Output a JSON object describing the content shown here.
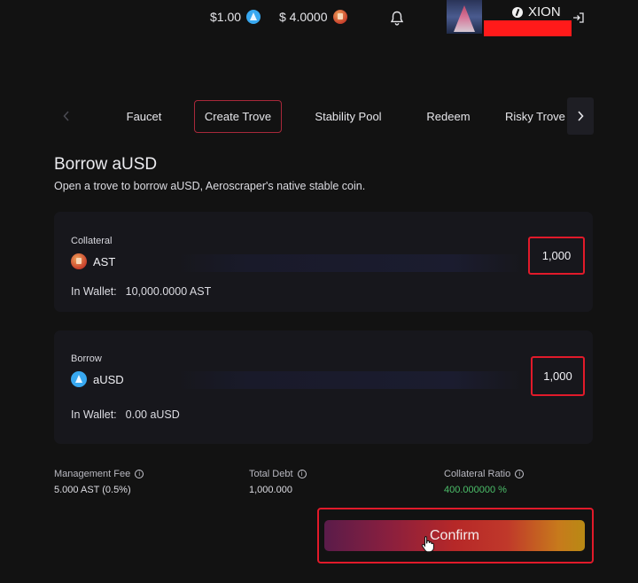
{
  "header": {
    "prices": [
      {
        "value": "$1.00",
        "icon": "ausd-coin-icon"
      },
      {
        "value": "$ 4.0000",
        "icon": "ast-coin-icon"
      }
    ],
    "chain": "XION"
  },
  "tabs": {
    "items": [
      {
        "label": "Faucet"
      },
      {
        "label": "Create Trove",
        "active": true
      },
      {
        "label": "Stability Pool"
      },
      {
        "label": "Redeem"
      },
      {
        "label": "Risky Trove"
      }
    ]
  },
  "page": {
    "title": "Borrow aUSD",
    "subtitle": "Open a trove to borrow aUSD, Aeroscraper's native stable coin."
  },
  "collateral": {
    "label": "Collateral",
    "asset": "AST",
    "amount": "1,000",
    "wallet_label": "In Wallet:",
    "wallet_value": "10,000.0000 AST"
  },
  "borrow": {
    "label": "Borrow",
    "asset": "aUSD",
    "amount": "1,000",
    "wallet_label": "In Wallet:",
    "wallet_value": "0.00 aUSD"
  },
  "stats": {
    "management_fee": {
      "label": "Management Fee",
      "value": "5.000 AST (0.5%)"
    },
    "total_debt": {
      "label": "Total Debt",
      "value": "1,000.000"
    },
    "collateral_ratio": {
      "label": "Collateral Ratio",
      "value": "400.000000 %"
    }
  },
  "confirm": {
    "label": "Confirm"
  },
  "colors": {
    "background": "#121212",
    "card": "#17171c",
    "accent_red": "#e11a2a",
    "positive": "#4cbf6a"
  }
}
